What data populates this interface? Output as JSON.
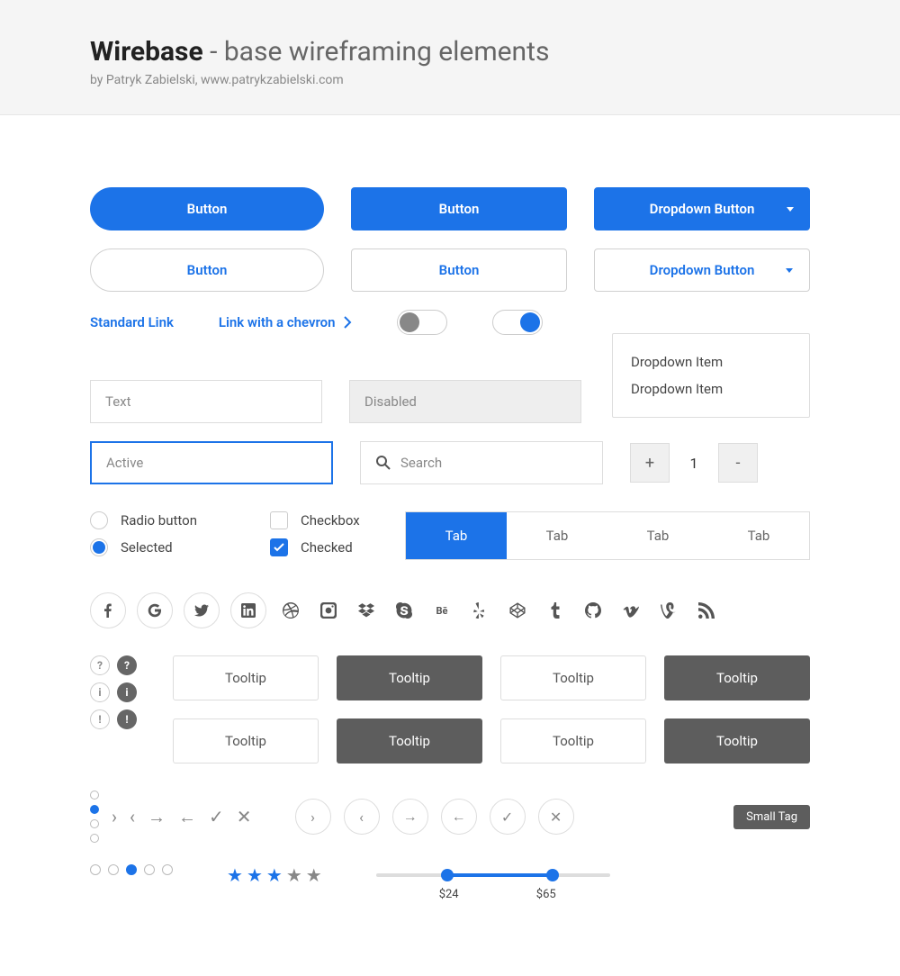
{
  "header": {
    "title_strong": "Wirebase",
    "title_rest": " - base wireframing elements",
    "byline": "by Patryk Zabielski, www.patrykzabielski.com"
  },
  "buttons": {
    "primary_pill": "Button",
    "primary_rect": "Button",
    "primary_dropdown": "Dropdown Button",
    "outline_pill": "Button",
    "outline_rect": "Button",
    "outline_dropdown": "Dropdown Button"
  },
  "links": {
    "standard": "Standard Link",
    "chevron": "Link with a chevron"
  },
  "dropdown_menu": {
    "item1": "Dropdown Item",
    "item2": "Dropdown Item"
  },
  "inputs": {
    "text": "Text",
    "disabled": "Disabled",
    "active": "Active",
    "search": "Search"
  },
  "stepper": {
    "minus": "-",
    "plus": "+",
    "value": "1"
  },
  "radio": {
    "unselected": "Radio button",
    "selected": "Selected"
  },
  "checkbox": {
    "unchecked": "Checkbox",
    "checked": "Checked"
  },
  "tabs": [
    "Tab",
    "Tab",
    "Tab",
    "Tab"
  ],
  "tooltips": [
    "Tooltip",
    "Tooltip",
    "Tooltip",
    "Tooltip",
    "Tooltip",
    "Tooltip",
    "Tooltip",
    "Tooltip"
  ],
  "info_symbols": {
    "question": "?",
    "info": "i",
    "excl": "!"
  },
  "tag": "Small Tag",
  "slider": {
    "min": "$24",
    "max": "$65"
  },
  "social": {
    "facebook": "f",
    "google": "G",
    "twitter": "t",
    "linkedin": "in",
    "dribbble": "db",
    "instagram": "ig",
    "dropbox": "db",
    "skype": "S",
    "behance": "Be",
    "yelp": "Y",
    "codepen": "cp",
    "tumblr": "t",
    "github": "gh",
    "vimeo": "V",
    "vine": "v",
    "rss": "rss"
  }
}
